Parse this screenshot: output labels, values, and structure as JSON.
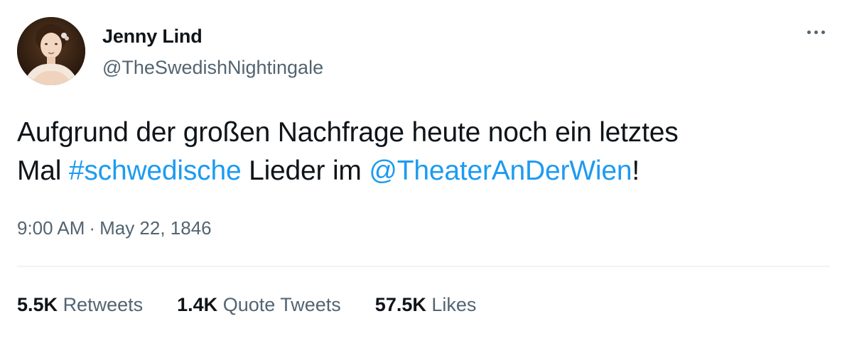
{
  "author": {
    "name": "Jenny Lind",
    "handle": "@TheSwedishNightingale"
  },
  "tweet": {
    "line1": "Aufgrund der großen Nachfrage heute noch ein letztes",
    "line2_prefix": "Mal ",
    "hashtag": "#schwedische",
    "line2_middle": " Lieder im ",
    "mention": "@TheaterAnDerWien",
    "line2_suffix": "!"
  },
  "meta": {
    "time": "9:00 AM",
    "separator": "·",
    "date": "May 22, 1846"
  },
  "stats": {
    "retweets_count": "5.5K",
    "retweets_label": "Retweets",
    "quotes_count": "1.4K",
    "quotes_label": "Quote Tweets",
    "likes_count": "57.5K",
    "likes_label": "Likes"
  },
  "colors": {
    "link": "#1d9bf0",
    "text": "#0f1419",
    "secondary": "#536471",
    "divider": "#eff3f4"
  },
  "icons": {
    "more": "more-horizontal-icon"
  }
}
